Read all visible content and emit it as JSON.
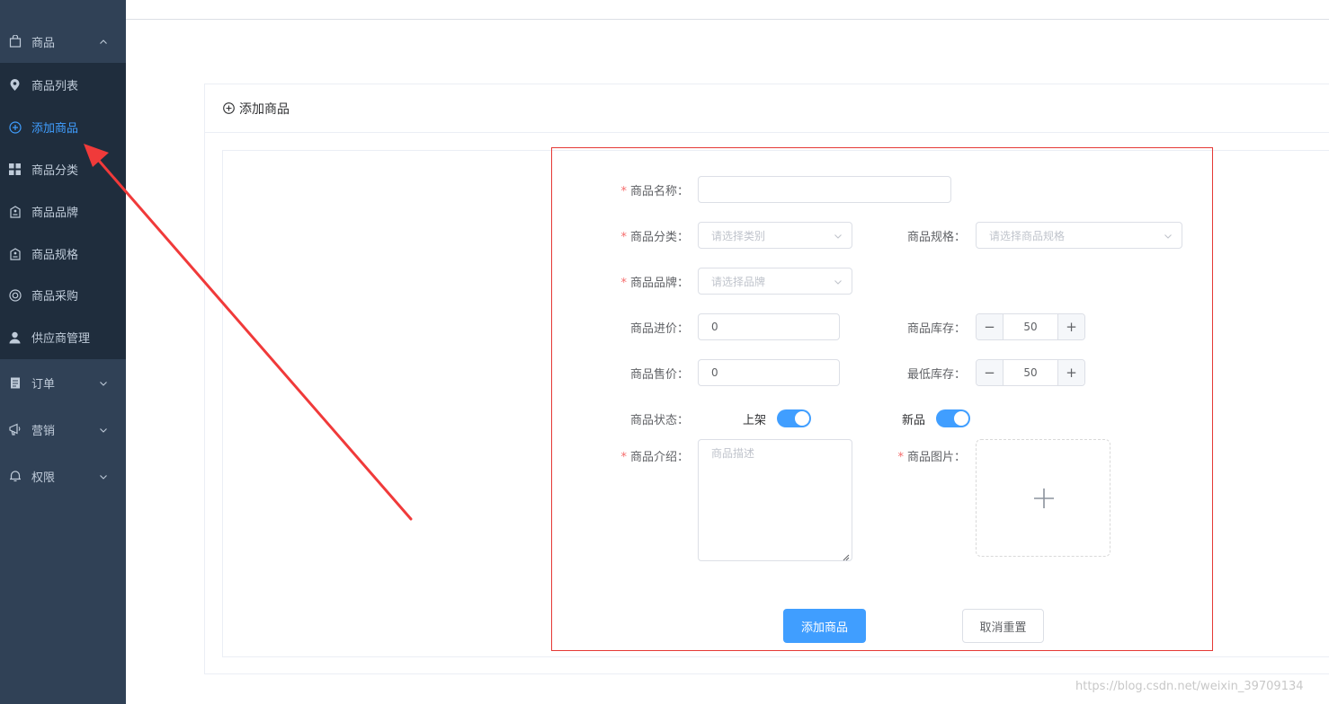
{
  "sidebar": {
    "top_menu": {
      "label": "商品",
      "icon": "shopping-bag-icon"
    },
    "items": [
      {
        "label": "商品列表",
        "icon": "location-pin-icon",
        "active": false
      },
      {
        "label": "添加商品",
        "icon": "plus-circle-icon",
        "active": true
      },
      {
        "label": "商品分类",
        "icon": "grid-icon",
        "active": false
      },
      {
        "label": "商品品牌",
        "icon": "tag-icon",
        "active": false
      },
      {
        "label": "商品规格",
        "icon": "tag-icon",
        "active": false
      },
      {
        "label": "商品采购",
        "icon": "lifebuoy-icon",
        "active": false
      },
      {
        "label": "供应商管理",
        "icon": "user-icon",
        "active": false
      }
    ],
    "groups": [
      {
        "label": "订单",
        "icon": "document-icon"
      },
      {
        "label": "营销",
        "icon": "megaphone-icon"
      },
      {
        "label": "权限",
        "icon": "bell-icon"
      }
    ]
  },
  "card": {
    "title": "添加商品"
  },
  "form": {
    "name_label": "商品名称：",
    "name_value": "",
    "category_label": "商品分类：",
    "category_placeholder": "请选择类别",
    "spec_label": "商品规格：",
    "spec_placeholder": "请选择商品规格",
    "brand_label": "商品品牌：",
    "brand_placeholder": "请选择品牌",
    "cost_label": "商品进价：",
    "cost_value": "0",
    "stock_label": "商品库存：",
    "stock_value": "50",
    "price_label": "商品售价：",
    "price_value": "0",
    "min_stock_label": "最低库存：",
    "min_stock_value": "50",
    "status_label": "商品状态：",
    "on_shelf_label": "上架",
    "on_shelf": true,
    "new_label": "新品",
    "is_new": true,
    "intro_label": "商品介绍：",
    "intro_placeholder": "商品描述",
    "image_label": "商品图片：",
    "minus": "−",
    "plus": "+",
    "required_mark": "*"
  },
  "buttons": {
    "submit": "添加商品",
    "reset": "取消重置"
  },
  "watermark": "https://blog.csdn.net/weixin_39709134",
  "colors": {
    "sidebar_bg": "#304156",
    "submenu_bg": "#1f2d3d",
    "accent": "#409eff",
    "frame_red": "#e53935"
  }
}
